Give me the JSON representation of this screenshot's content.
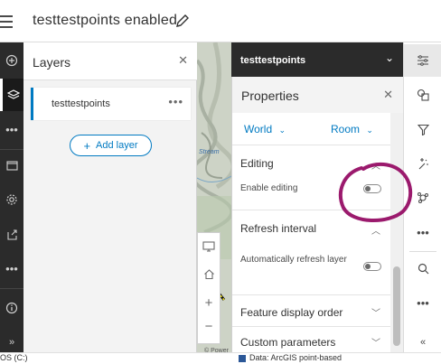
{
  "header": {
    "title": "testtestpoints enabled"
  },
  "layers_panel": {
    "title": "Layers",
    "items": [
      {
        "name": "testtestpoints"
      }
    ],
    "add_layer_label": "Add layer"
  },
  "properties_panel": {
    "layer_name": "testtestpoints",
    "title": "Properties",
    "tabs": [
      {
        "label": "World"
      },
      {
        "label": "Room"
      }
    ],
    "sections": {
      "editing": {
        "title": "Editing",
        "enable_label": "Enable editing",
        "enabled": false
      },
      "refresh": {
        "title": "Refresh interval",
        "auto_label": "Automatically refresh layer",
        "enabled": false
      },
      "feature_order": {
        "title": "Feature display order"
      },
      "custom_params": {
        "title": "Custom parameters"
      }
    }
  },
  "map": {
    "stream_label": "Stream",
    "attribution": "© Power"
  },
  "taskbar": {
    "left_text": "OS (C:)",
    "right_text": "Data: ArcGIS point-based"
  },
  "colors": {
    "accent": "#007ac2",
    "annotation": "#9b1a6d",
    "dark_header": "#2b2b2b"
  },
  "icons": {
    "left_toolbar": [
      "add-icon",
      "layers-icon",
      "more-icon",
      "basemap-icon",
      "settings-icon",
      "share-icon",
      "more-icon",
      "info-icon",
      "expand-icon"
    ],
    "right_toolbar": [
      "properties-icon",
      "styles-icon",
      "filter-icon",
      "effects-icon",
      "clustering-icon",
      "more-icon",
      "search-icon",
      "more-icon",
      "collapse-icon"
    ]
  }
}
